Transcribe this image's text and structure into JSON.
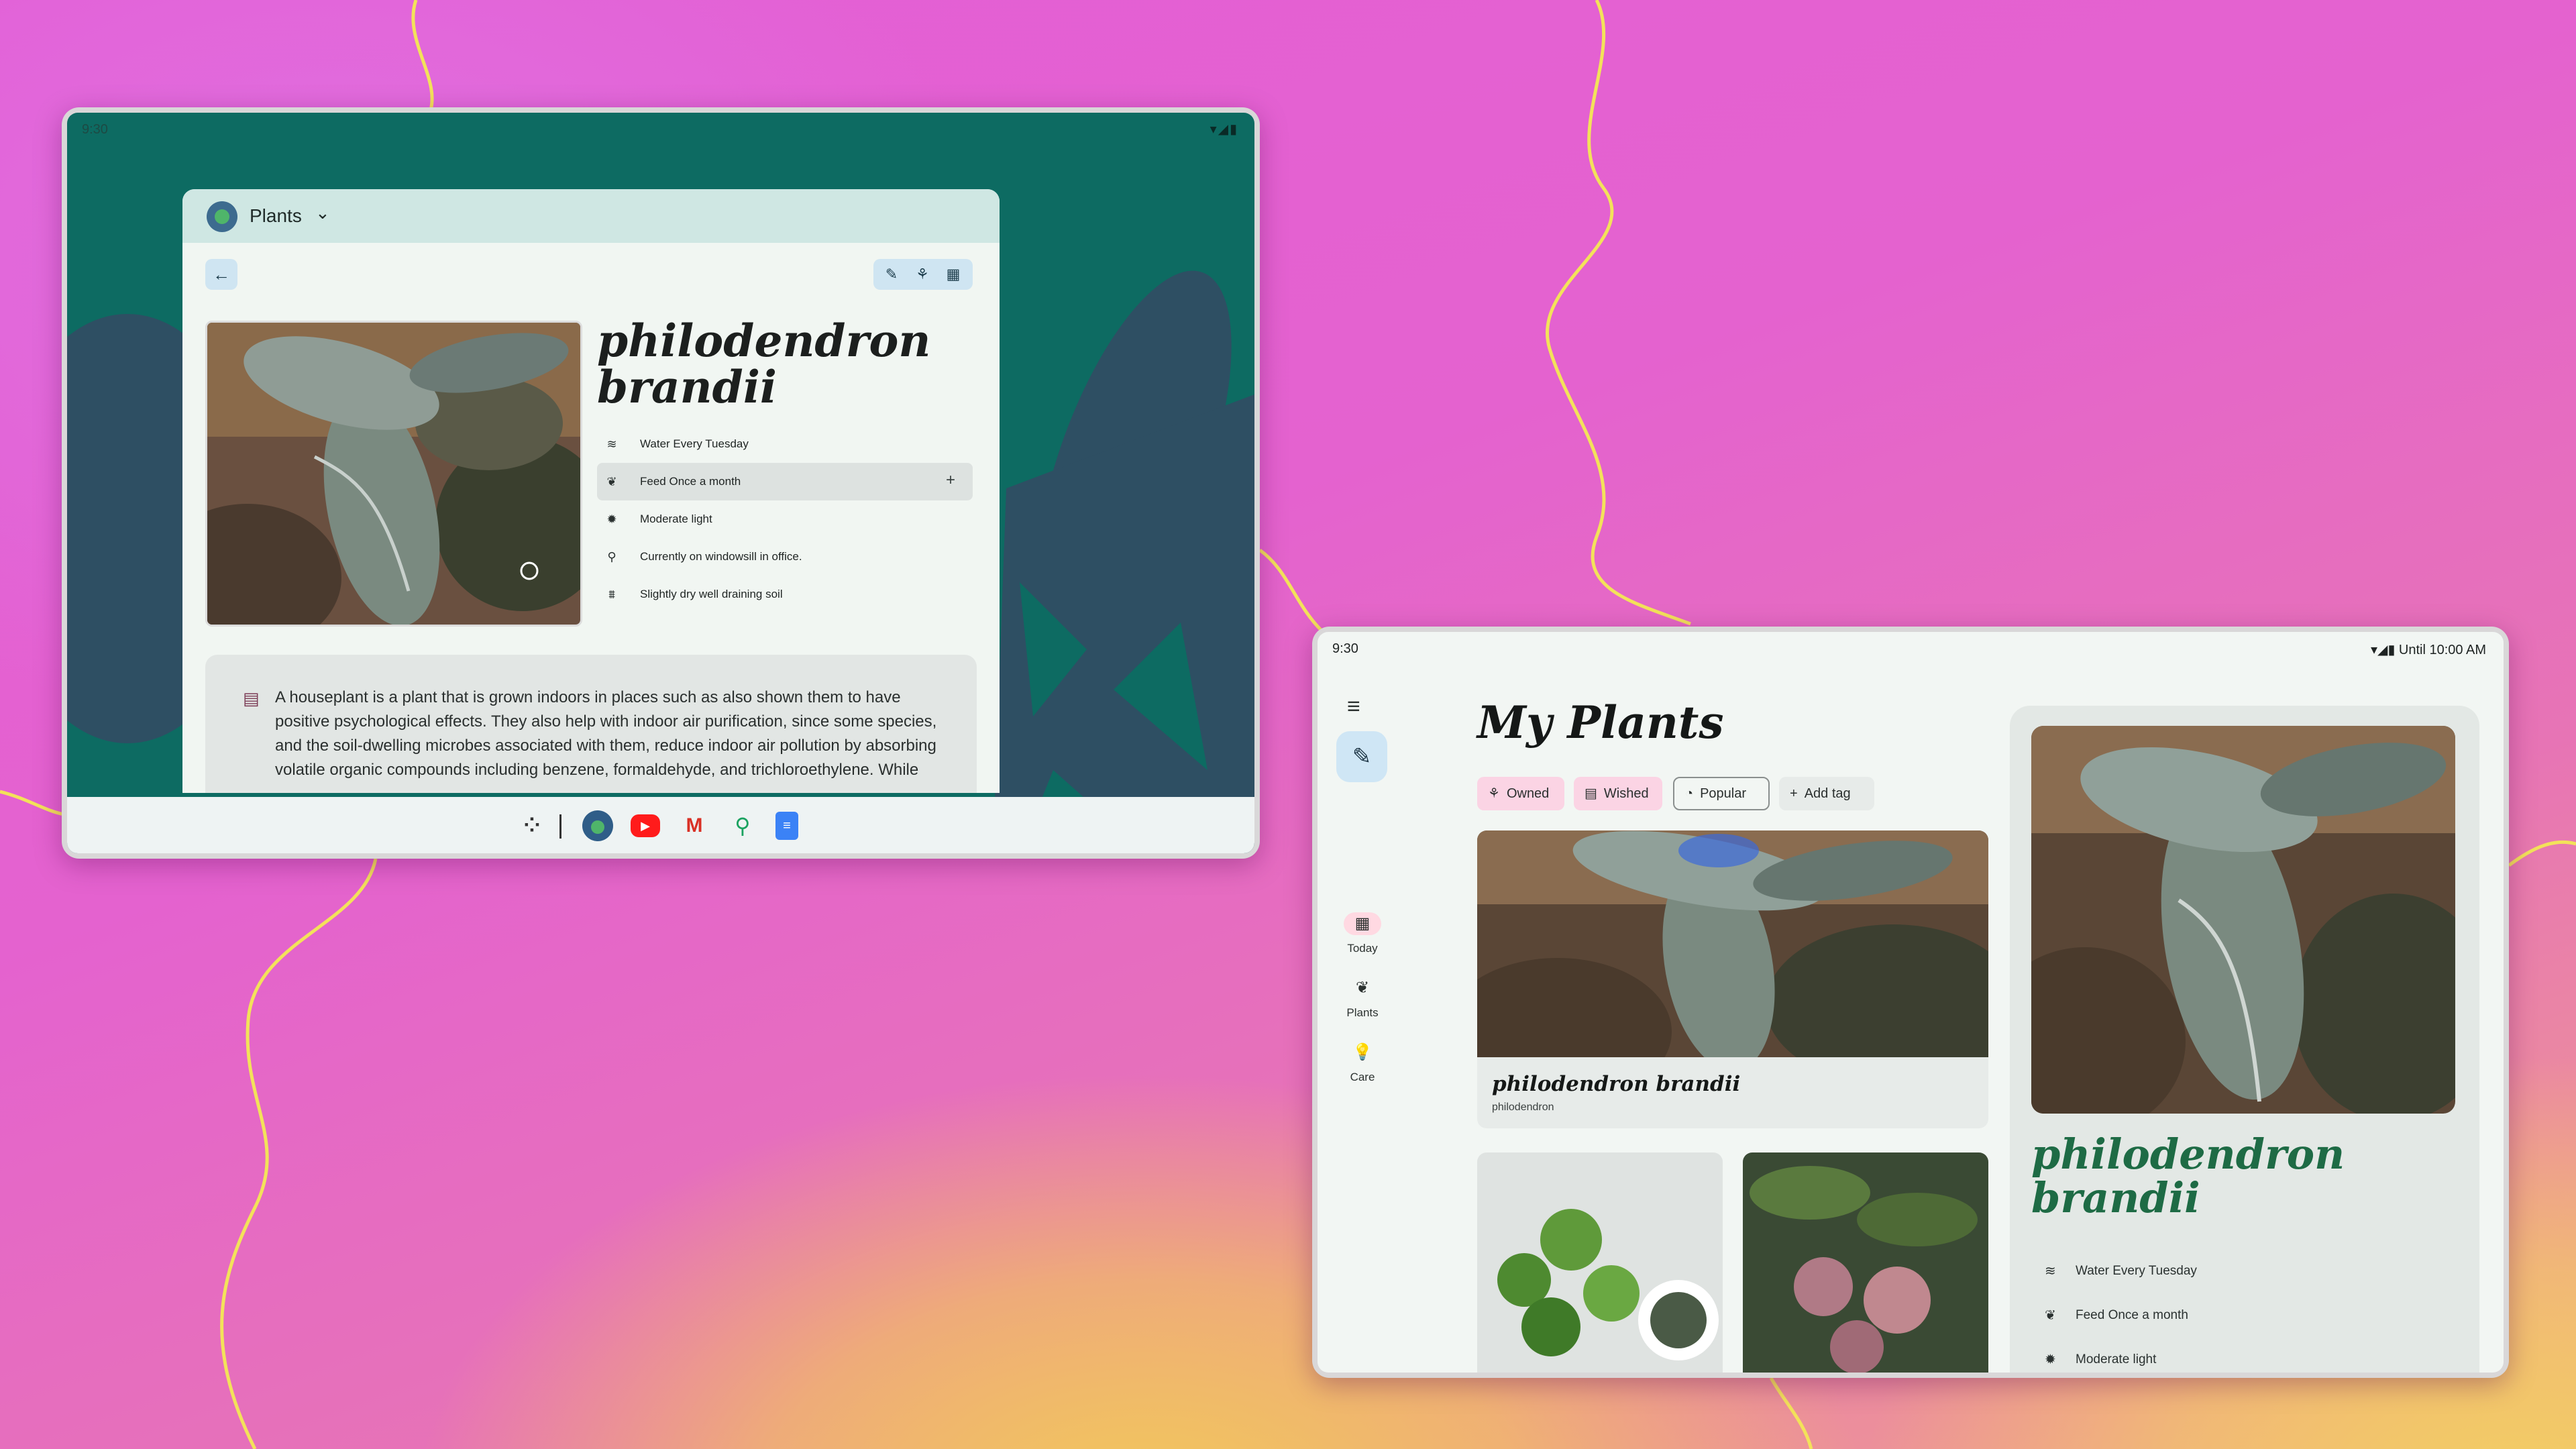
{
  "colors": {
    "left_wallpaper": "#0d6b62",
    "wall_shapes": "#2e4f63",
    "app_titlebar": "#cfe7e3",
    "detail_title_green": "#1e6b45",
    "chip_pink": "#fbd4e4"
  },
  "left_device": {
    "status_time": "9:30",
    "app": {
      "title": "Plants",
      "plant_name": "philodendron brandii",
      "care": [
        {
          "icon": "water-icon",
          "label": "Water Every Tuesday"
        },
        {
          "icon": "leaf-icon",
          "label": "Feed Once a month"
        },
        {
          "icon": "sun-icon",
          "label": "Moderate light"
        },
        {
          "icon": "location-pin-icon",
          "label": "Currently on windowsill in office."
        },
        {
          "icon": "soil-icon",
          "label": "Slightly dry well draining soil"
        }
      ],
      "description": "A houseplant is a plant that is grown indoors in places such as also shown them to have positive psychological effects. They also help with indoor air purification, since some species, and the soil-dwelling microbes associated with them, reduce indoor air pollution by absorbing volatile organic compounds including benzene, formaldehyde, and trichloroethylene. While"
    },
    "taskbar": [
      "launcher-icon",
      "plants-app-icon",
      "youtube-icon",
      "gmail-icon",
      "maps-icon",
      "docs-icon"
    ]
  },
  "right_device": {
    "status_time": "9:30",
    "status_right": "Until 10:00 AM",
    "title": "My Plants",
    "rail": [
      {
        "icon": "calendar-icon",
        "label": "Today"
      },
      {
        "icon": "leaf-icon",
        "label": "Plants"
      },
      {
        "icon": "bulb-icon",
        "label": "Care"
      }
    ],
    "chips": [
      {
        "icon": "owned-icon",
        "label": "Owned"
      },
      {
        "icon": "wished-icon",
        "label": "Wished"
      },
      {
        "icon": "popular-icon",
        "label": "Popular"
      },
      {
        "icon": "plus-icon",
        "label": "Add tag"
      }
    ],
    "card": {
      "title": "philodendron brandii",
      "subtitle": "philodendron"
    },
    "detail": {
      "plant_name": "philodendron brandii",
      "care": [
        {
          "icon": "water-icon",
          "label": "Water Every Tuesday"
        },
        {
          "icon": "leaf-icon",
          "label": "Feed Once a month"
        },
        {
          "icon": "sun-icon",
          "label": "Moderate light"
        }
      ]
    }
  }
}
